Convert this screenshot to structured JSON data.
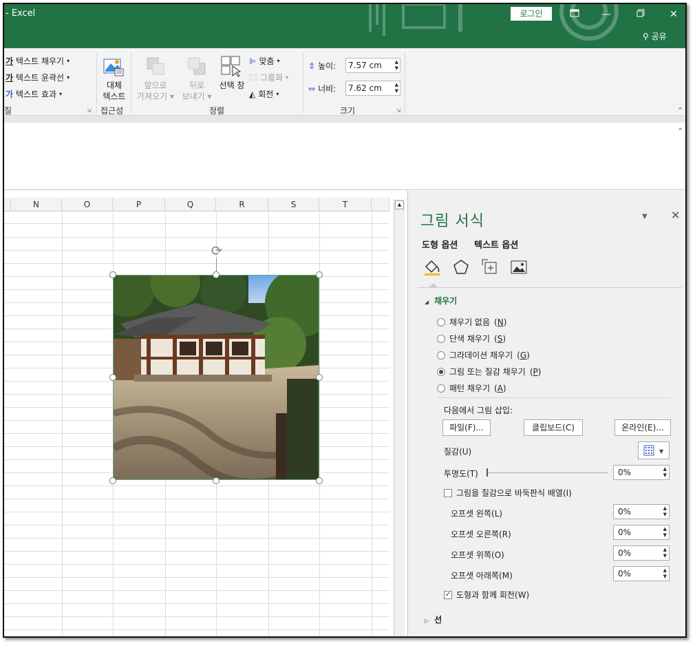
{
  "titlebar": {
    "app_title": "- Excel",
    "login": "로그인",
    "share": "공유",
    "icons": [
      "ribbon-display-icon",
      "minimize-icon",
      "restore-icon",
      "close-icon"
    ]
  },
  "ribbon": {
    "wordart": {
      "fill": "텍스트 채우기",
      "outline": "텍스트 윤곽선",
      "effects": "텍스트 효과"
    },
    "accessibility": {
      "alt_text_line1": "대체",
      "alt_text_line2": "텍스트",
      "group_label": "접근성"
    },
    "arrange": {
      "bring_forward_line1": "앞으로",
      "bring_forward_line2": "가져오기",
      "send_backward_line1": "뒤로",
      "send_backward_line2": "보내기",
      "selection_pane": "선택 창",
      "align": "맞춤",
      "group": "그룹화",
      "rotate": "회전",
      "group_label": "정렬"
    },
    "size": {
      "height_label": "높이:",
      "height_value": "7.57 cm",
      "width_label": "너비:",
      "width_value": "7.62 cm",
      "group_label": "크기"
    },
    "left_fragment_1": "질",
    "left_fragment_2": "스"
  },
  "grid": {
    "columns": [
      "N",
      "O",
      "P",
      "Q",
      "R",
      "S",
      "T"
    ]
  },
  "pane": {
    "title": "그림 서식",
    "tabs": [
      "도형 옵션",
      "텍스트 옵션"
    ],
    "fill_section": "채우기",
    "fill_options": [
      {
        "label": "채우기 없음",
        "key": "N",
        "checked": false
      },
      {
        "label": "단색 채우기",
        "key": "S",
        "checked": false
      },
      {
        "label": "그라데이션 채우기",
        "key": "G",
        "checked": false
      },
      {
        "label": "그림 또는 질감 채우기",
        "key": "P",
        "checked": true
      },
      {
        "label": "패턴 채우기",
        "key": "A",
        "checked": false
      }
    ],
    "insert_from": "다음에서 그림 삽입:",
    "buttons": {
      "file": "파일(F)...",
      "clipboard": "클립보드(C)",
      "online": "온라인(E)..."
    },
    "texture_label": "질감(U)",
    "transparency_label": "투명도(T)",
    "transparency_value": "0%",
    "tile_label": "그림을 질감으로 바둑판식 배열(I)",
    "tile_checked": false,
    "offsets": [
      {
        "label": "오프셋 왼쪽(L)",
        "value": "0%"
      },
      {
        "label": "오프셋 오른쪽(R)",
        "value": "0%"
      },
      {
        "label": "오프셋 위쪽(O)",
        "value": "0%"
      },
      {
        "label": "오프셋 아래쪽(M)",
        "value": "0%"
      }
    ],
    "rotate_with_shape": "도형과 함께 회전(W)",
    "rotate_checked": true,
    "line_section": "선"
  },
  "colors": {
    "accent": "#217346"
  }
}
